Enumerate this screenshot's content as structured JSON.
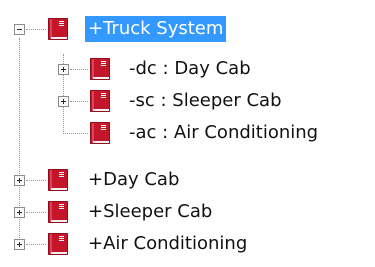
{
  "tree": {
    "nodes": [
      {
        "label": "+Truck System",
        "expander": "minus",
        "selected": true
      },
      {
        "label": "-dc : Day Cab",
        "expander": "plus",
        "selected": false
      },
      {
        "label": "-sc : Sleeper Cab",
        "expander": "plus",
        "selected": false
      },
      {
        "label": "-ac : Air Conditioning",
        "expander": "none",
        "selected": false
      },
      {
        "label": "+Day Cab",
        "expander": "plus",
        "selected": false
      },
      {
        "label": "+Sleeper Cab",
        "expander": "plus",
        "selected": false
      },
      {
        "label": "+Air Conditioning",
        "expander": "plus",
        "selected": false
      }
    ]
  },
  "colors": {
    "selection": "#3399ff",
    "book": "#c4162a"
  },
  "icons": {
    "node": "red-book-icon",
    "expand": "plus-box-icon",
    "collapse": "minus-box-icon"
  }
}
